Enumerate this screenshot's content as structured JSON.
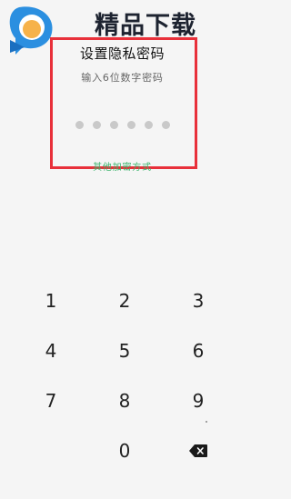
{
  "watermark": {
    "text": "精品下载"
  },
  "screen": {
    "title": "设置隐私密码",
    "subtitle": "输入6位数字密码",
    "pin_length": 6,
    "other_method_link": "其他加密方式"
  },
  "keypad": {
    "keys": [
      "1",
      "2",
      "3",
      "4",
      "5",
      "6",
      "7",
      "8",
      "9",
      "0"
    ],
    "backspace_icon": "backspace-icon"
  },
  "colors": {
    "accent_green": "#3fb66f",
    "highlight_red": "#e8303a",
    "dot_gray": "#c9c9c9",
    "background": "#f5f5f5"
  }
}
